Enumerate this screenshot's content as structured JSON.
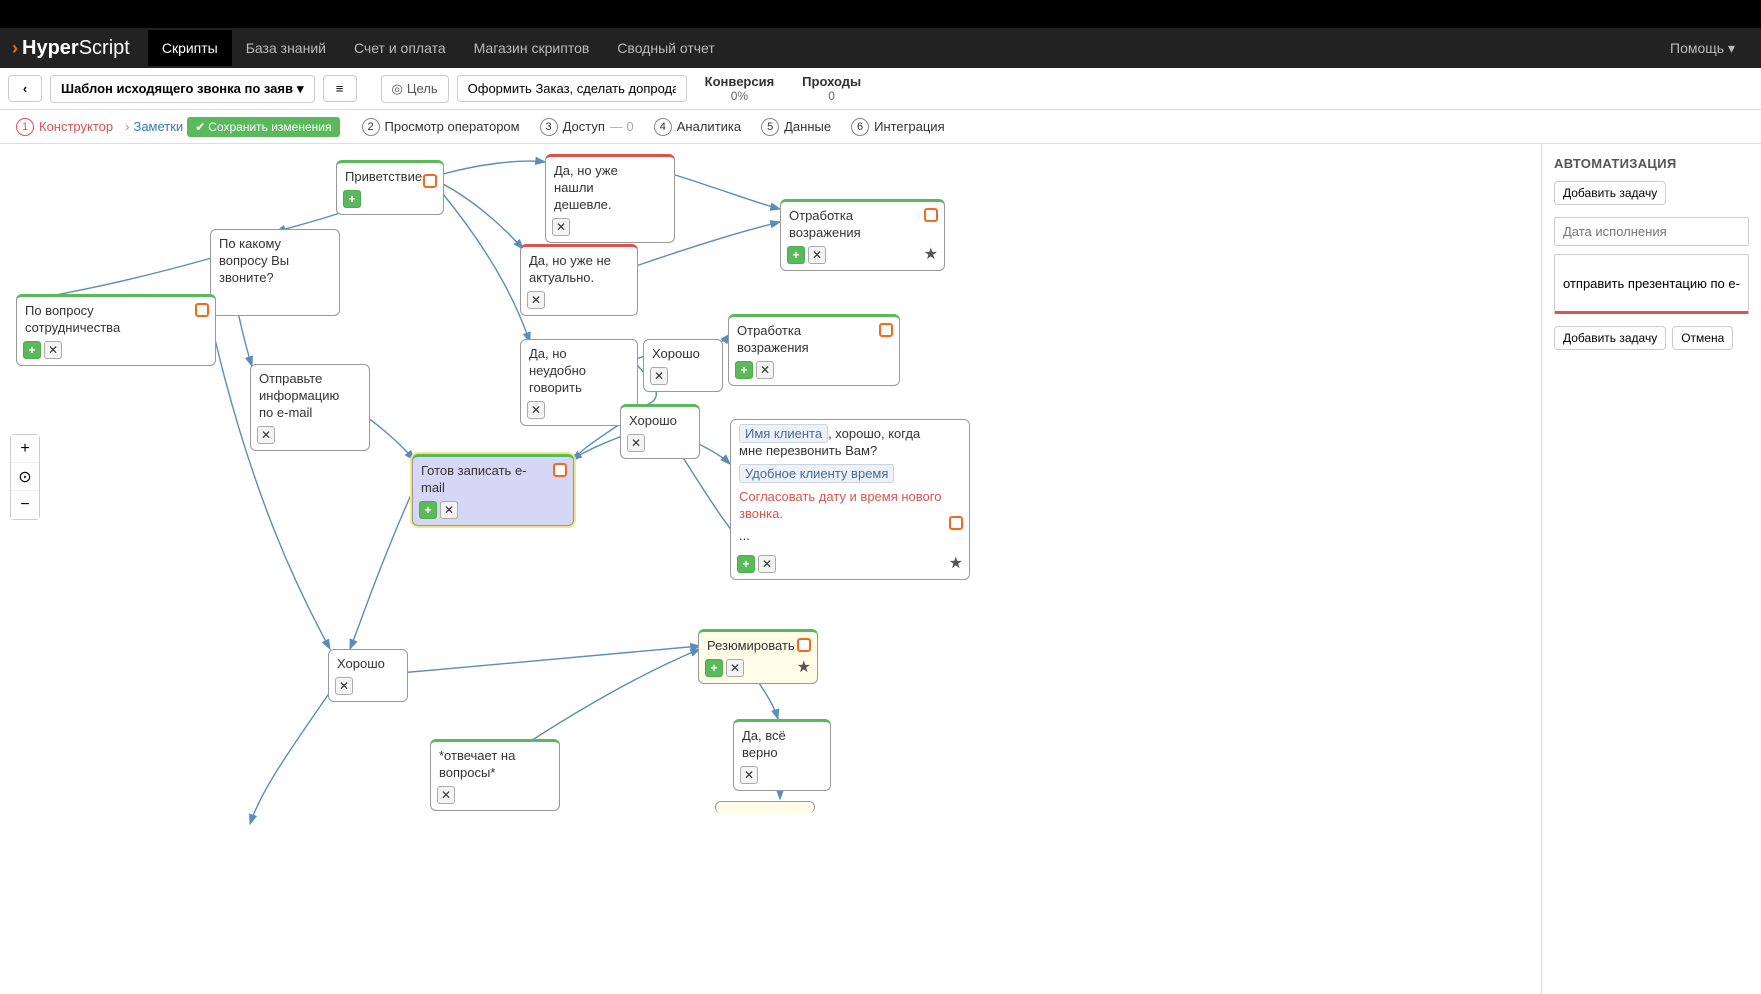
{
  "logo": {
    "bold": "Hyper",
    "light": "Script"
  },
  "nav": {
    "items": [
      "Скрипты",
      "База знаний",
      "Счет и оплата",
      "Магазин скриптов",
      "Сводный отчет"
    ],
    "help": "Помощь"
  },
  "toolbar": {
    "back": "‹",
    "script_name": "Шаблон исходящего звонка по заяв",
    "menu_icon": "≡",
    "goal_label": "Цель",
    "goal_value": "Оформить Заказ, сделать допродажу",
    "stats": {
      "conv_label": "Конверсия",
      "conv_val": "0%",
      "pass_label": "Проходы",
      "pass_val": "0"
    }
  },
  "tabs": {
    "t1": "Конструктор",
    "t1_sub": "Заметки",
    "save": "Сохранить изменения",
    "t2": "Просмотр оператором",
    "t3": "Доступ",
    "t3_count": "— 0",
    "t4": "Аналитика",
    "t5": "Данные",
    "t6": "Интеграция"
  },
  "zoom": {
    "plus": "+",
    "center": "⊙",
    "minus": "−"
  },
  "side": {
    "title": "АВТОМАТИЗАЦИЯ",
    "add_task": "Добавить задачу",
    "date_placeholder": "Дата исполнения",
    "task_text": "отправить презентацию по e-mail",
    "add_task2": "Добавить задачу",
    "cancel": "Отмена"
  },
  "nodes": {
    "n1": "Приветствие",
    "n2": "По какому вопросу Вы звоните?",
    "n3": "По вопросу сотрудничества",
    "n4": "Отправьте информацию по e-mail",
    "n5": "Да, но уже нашли дешевле.",
    "n6": "Отработка возражения",
    "n7": "Да, но уже не актуально.",
    "n8": "Да, но неудобно говорить",
    "n9": "Хорошо",
    "n10": "Отработка возражения",
    "n11": "Хорошо",
    "n12": "Готов записать e-mail",
    "n13_chip1": "Имя клиента",
    "n13_text1": ", хорошо, когда мне перезвонить Вам?",
    "n13_chip2": "Удобное клиенту время",
    "n13_goal": "Согласовать дату и время нового звонка.",
    "n13_dots": "...",
    "n14": "Хорошо",
    "n15": "Резюмировать",
    "n16": "Да, всё верно",
    "n17": "*отвечает на вопросы*"
  }
}
